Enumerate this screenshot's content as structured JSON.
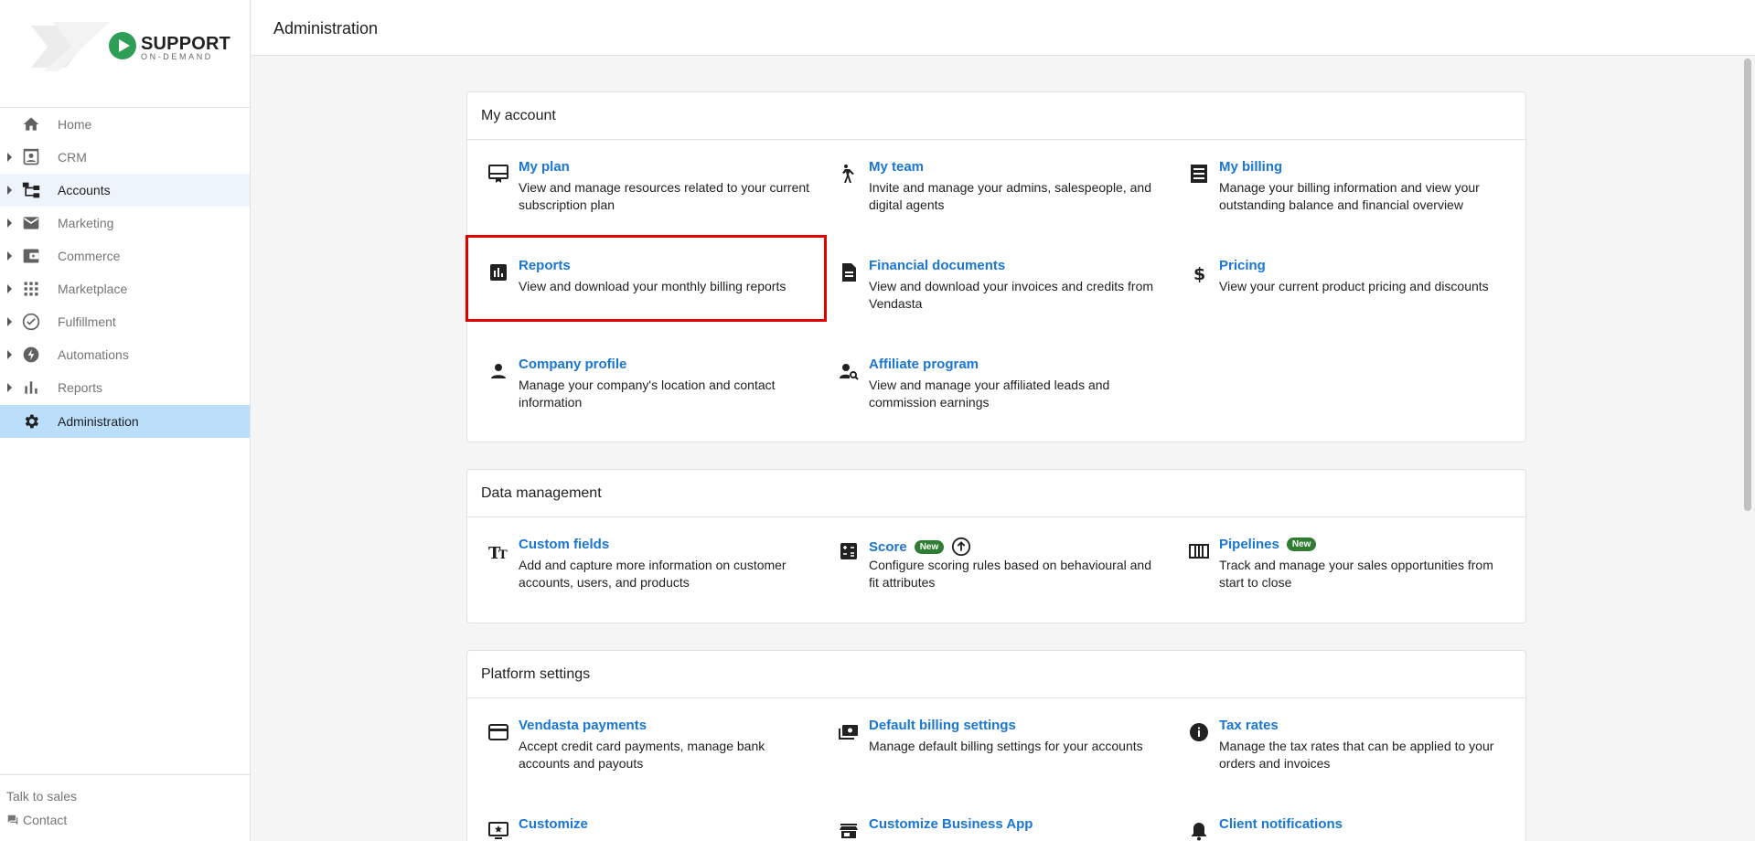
{
  "brand": {
    "name": "SUPPORT",
    "tagline": "ON-DEMAND"
  },
  "sidebar": {
    "items": [
      {
        "label": "Home",
        "icon": "home-icon",
        "caret": false
      },
      {
        "label": "CRM",
        "icon": "contact-card-icon",
        "caret": true
      },
      {
        "label": "Accounts",
        "icon": "account-tree-icon",
        "caret": true
      },
      {
        "label": "Marketing",
        "icon": "mail-icon",
        "caret": true
      },
      {
        "label": "Commerce",
        "icon": "wallet-icon",
        "caret": true
      },
      {
        "label": "Marketplace",
        "icon": "apps-grid-icon",
        "caret": true
      },
      {
        "label": "Fulfillment",
        "icon": "check-circle-icon",
        "caret": true
      },
      {
        "label": "Automations",
        "icon": "bolt-icon",
        "caret": true
      },
      {
        "label": "Reports",
        "icon": "bar-chart-icon",
        "caret": true
      },
      {
        "label": "Administration",
        "icon": "gear-icon",
        "caret": false
      }
    ],
    "footer": {
      "talk_label": "Talk to sales",
      "contact_label": "Contact"
    }
  },
  "header": {
    "title": "Administration"
  },
  "sections": {
    "my_account": {
      "title": "My account",
      "items": [
        {
          "title": "My plan",
          "desc": "View and manage resources related to your current subscription plan",
          "icon": "plan-icon"
        },
        {
          "title": "My team",
          "desc": "Invite and manage your admins, salespeople, and digital agents",
          "icon": "team-icon"
        },
        {
          "title": "My billing",
          "desc": "Manage your billing information and view your outstanding balance and financial overview",
          "icon": "receipt-icon"
        },
        {
          "title": "Reports",
          "desc": "View and download your monthly billing reports",
          "icon": "assessment-icon"
        },
        {
          "title": "Financial documents",
          "desc": "View and download your invoices and credits from Vendasta",
          "icon": "document-icon"
        },
        {
          "title": "Pricing",
          "desc": "View your current product pricing and discounts",
          "icon": "dollar-icon"
        },
        {
          "title": "Company profile",
          "desc": "Manage your company's location and contact information",
          "icon": "person-icon"
        },
        {
          "title": "Affiliate program",
          "desc": "View and manage your affiliated leads and commission earnings",
          "icon": "person-search-icon"
        }
      ]
    },
    "data_management": {
      "title": "Data management",
      "items": [
        {
          "title": "Custom fields",
          "desc": "Add and capture more information on customer accounts, users, and products",
          "icon": "text-fields-icon"
        },
        {
          "title": "Score",
          "badge": "New",
          "desc": "Configure scoring rules based on behavioural and fit attributes",
          "icon": "calculate-icon"
        },
        {
          "title": "Pipelines",
          "badge": "New",
          "desc": "Track and manage your sales opportunities from start to close",
          "icon": "view-column-icon"
        }
      ]
    },
    "platform_settings": {
      "title": "Platform settings",
      "items": [
        {
          "title": "Vendasta payments",
          "desc": "Accept credit card payments, manage bank accounts and payouts",
          "icon": "credit-card-icon"
        },
        {
          "title": "Default billing settings",
          "desc": "Manage default billing settings for your accounts",
          "icon": "payments-icon"
        },
        {
          "title": "Tax rates",
          "desc": "Manage the tax rates that can be applied to your orders and invoices",
          "icon": "info-icon"
        },
        {
          "title": "Customize",
          "desc": "",
          "icon": "desktop-star-icon"
        },
        {
          "title": "Customize Business App",
          "desc": "",
          "icon": "storefront-icon"
        },
        {
          "title": "Client notifications",
          "desc": "",
          "icon": "bell-icon"
        }
      ]
    }
  },
  "colors": {
    "link": "#1976d2",
    "active_nav": "#bbdefb",
    "new_badge": "#2e7d32",
    "highlight": "#e00000"
  }
}
